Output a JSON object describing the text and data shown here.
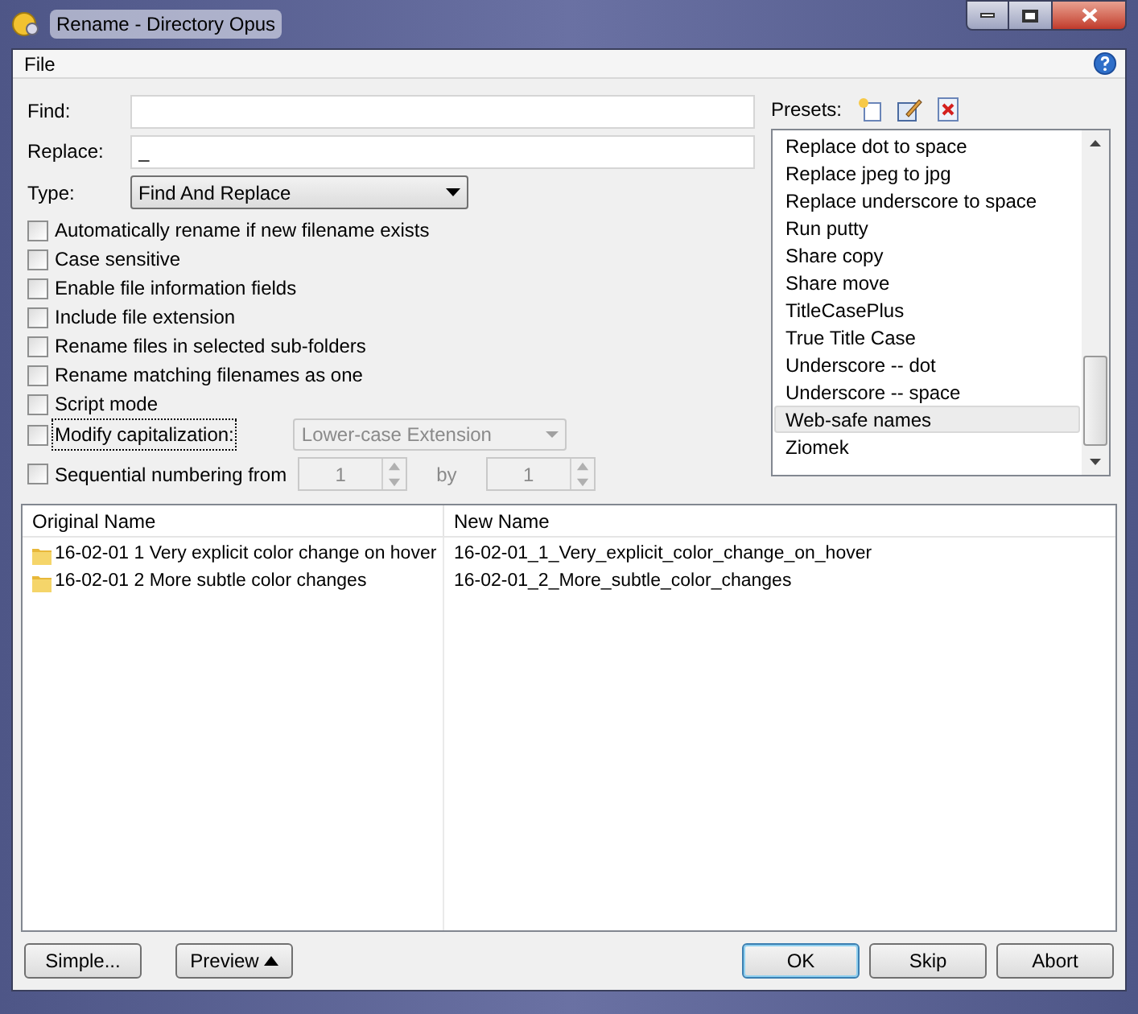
{
  "window": {
    "title": "Rename - Directory Opus"
  },
  "menu": [
    "File"
  ],
  "find": {
    "label": "Find:"
  },
  "replace": {
    "label": "Replace:",
    "value": "_"
  },
  "type": {
    "label": "Type:",
    "value": "Find And Replace"
  },
  "options": [
    {
      "label": "Automatically rename if new filename exists",
      "checked": false,
      "focused": false
    },
    {
      "label": "Case sensitive",
      "checked": false,
      "focused": false
    },
    {
      "label": "Enable file information fields",
      "checked": false,
      "focused": false
    },
    {
      "label": "Include file extension",
      "checked": false,
      "focused": false
    },
    {
      "label": "Rename files in selected sub-folders",
      "checked": false,
      "focused": false
    },
    {
      "label": "Rename matching filenames as one",
      "checked": false,
      "focused": false
    },
    {
      "label": "Script mode",
      "checked": false,
      "focused": false
    },
    {
      "label": "Modify capitalization:",
      "checked": false,
      "focused": true
    }
  ],
  "capitalization": {
    "value": "Lower-case Extension",
    "disabled": true
  },
  "numbering": {
    "label": "Sequential numbering from",
    "checked": false,
    "focused": false,
    "from": "1",
    "by_label": "by",
    "by": "1",
    "disabled": true
  },
  "presets": {
    "label": "Presets:",
    "items": [
      {
        "label": "Replace dot to space",
        "selected": false
      },
      {
        "label": "Replace jpeg to jpg",
        "selected": false
      },
      {
        "label": "Replace underscore to space",
        "selected": false
      },
      {
        "label": "Run putty",
        "selected": false
      },
      {
        "label": "Share copy",
        "selected": false
      },
      {
        "label": "Share move",
        "selected": false
      },
      {
        "label": "TitleCasePlus",
        "selected": false
      },
      {
        "label": "True Title Case",
        "selected": false
      },
      {
        "label": "Underscore -- dot",
        "selected": false
      },
      {
        "label": "Underscore -- space",
        "selected": false
      },
      {
        "label": "Web-safe names",
        "selected": true
      },
      {
        "label": "Ziomek",
        "selected": false
      }
    ]
  },
  "table": {
    "columns": [
      "Original Name",
      "New Name"
    ],
    "rows": [
      [
        "16-02-01 1 Very explicit color change on hover",
        "16-02-01_1_Very_explicit_color_change_on_hover"
      ],
      [
        "16-02-01 2 More subtle color changes",
        "16-02-01_2_More_subtle_color_changes"
      ]
    ]
  },
  "buttons_left": [
    {
      "label": "Simple...",
      "caret": false
    },
    {
      "label": "Preview",
      "caret": true
    }
  ],
  "buttons_right": [
    {
      "label": "OK",
      "default": true
    },
    {
      "label": "Skip",
      "default": false
    },
    {
      "label": "Abort",
      "default": false
    }
  ]
}
